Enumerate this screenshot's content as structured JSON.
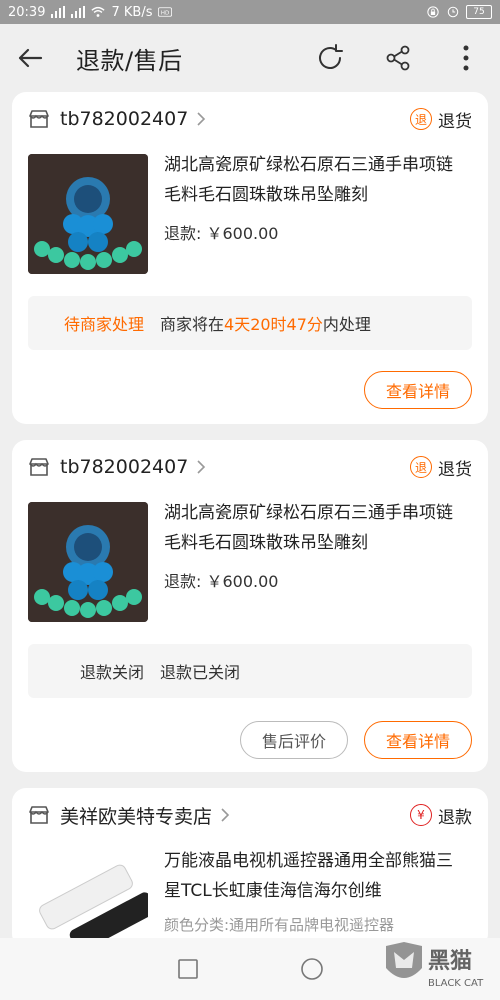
{
  "status_bar": {
    "time": "20:39",
    "net_speed": "7 KB/s",
    "battery": "75"
  },
  "header": {
    "title": "退款/售后"
  },
  "orders": [
    {
      "store": "tb782002407",
      "status_icon_text": "退",
      "status": "退货",
      "product_title": "湖北高瓷原矿绿松石原石三通手串项链毛料毛石圆珠散珠吊坠雕刻",
      "refund_label": "退款:",
      "refund_amount": "￥600.00",
      "state_label": "待商家处理",
      "state_prefix": "商家将在",
      "state_highlight": "4天20时47分",
      "state_suffix": "内处理",
      "detail_button": "查看详情"
    },
    {
      "store": "tb782002407",
      "status_icon_text": "退",
      "status": "退货",
      "product_title": "湖北高瓷原矿绿松石原石三通手串项链毛料毛石圆珠散珠吊坠雕刻",
      "refund_label": "退款:",
      "refund_amount": "￥600.00",
      "state_label": "退款关闭",
      "state_text": "退款已关闭",
      "review_button": "售后评价",
      "detail_button": "查看详情"
    },
    {
      "store": "美祥欧美特专卖店",
      "status_icon_text": "¥",
      "status": "退款",
      "product_title": "万能液晶电视机遥控器通用全部熊猫三星TCL长虹康佳海信海尔创维",
      "sku": "颜色分类:通用所有品牌电视遥控器"
    }
  ],
  "watermark": {
    "text_cn": "黑猫",
    "text_en": "BLACK CAT"
  },
  "colors": {
    "accent": "#ff6a00",
    "refund_red": "#e02020"
  }
}
